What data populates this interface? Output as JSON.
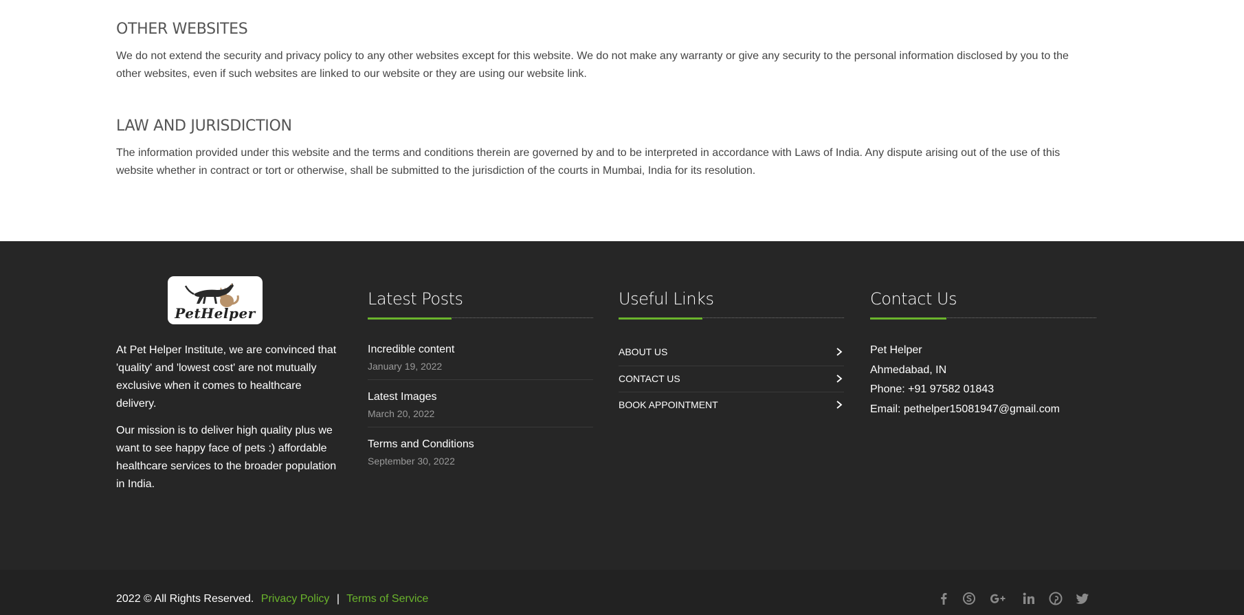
{
  "sections": [
    {
      "title": "OTHER WEBSITES",
      "text": "We do not extend the security and privacy policy to any other websites except for this website. We do not make any warranty or give any security to the personal information disclosed by you to the other websites, even if such websites are linked to our website or they are using our website link."
    },
    {
      "title": "LAW AND JURISDICTION",
      "text": "The information provided under this website and the terms and conditions therein are governed by and to be interpreted in accordance with Laws of India. Any dispute arising out of the use of this website whether in contract or tort or otherwise, shall be submitted to the jurisdiction of the courts in Mumbai, India for its resolution."
    }
  ],
  "footer": {
    "about": {
      "logo_text": "PetHelper",
      "paragraphs": [
        "At Pet Helper Institute, we are convinced that 'quality' and 'lowest cost' are not mutually exclusive when it comes to healthcare delivery.",
        "Our mission is to deliver high quality plus we want to see happy face of pets :) affordable healthcare services to the broader population in India."
      ]
    },
    "latest_posts": {
      "title": "Latest Posts",
      "posts": [
        {
          "title": "Incredible content",
          "date": "January 19, 2022"
        },
        {
          "title": "Latest Images",
          "date": "March 20, 2022"
        },
        {
          "title": "Terms and Conditions",
          "date": "September 30, 2022"
        }
      ]
    },
    "useful_links": {
      "title": "Useful Links",
      "links": [
        "ABOUT US",
        "CONTACT US",
        "BOOK APPOINTMENT"
      ]
    },
    "contact": {
      "title": "Contact Us",
      "name": "Pet Helper",
      "location": "Ahmedabad, IN",
      "phone": "Phone: +91 97582 01843",
      "email": "Email: pethelper15081947@gmail.com"
    }
  },
  "bottom_bar": {
    "copyright": "2022 © All Rights Reserved.",
    "privacy_link": "Privacy Policy",
    "separator": "|",
    "terms_link": "Terms of Service",
    "social_icons": [
      "facebook-icon",
      "skype-icon",
      "google-plus-icon",
      "linkedin-icon",
      "pinterest-icon",
      "twitter-icon"
    ]
  },
  "colors": {
    "accent": "#6ab42c",
    "footer_bg": "#262626",
    "bottom_bar_bg": "#222222"
  }
}
